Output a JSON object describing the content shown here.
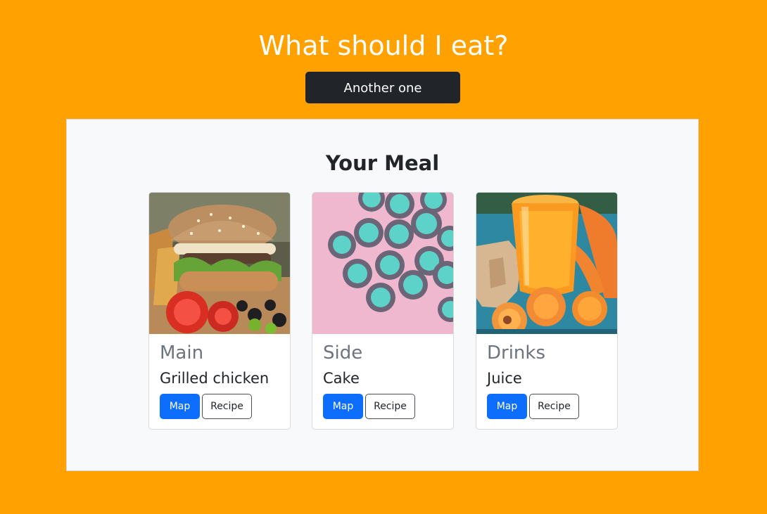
{
  "header": {
    "title": "What should I eat?",
    "another_button_label": "Another one"
  },
  "meal": {
    "title": "Your Meal",
    "cards": [
      {
        "category": "Main",
        "dish": "Grilled chicken",
        "image_alt": "burger-and-tomatoes-image",
        "map_label": "Map",
        "recipe_label": "Recipe"
      },
      {
        "category": "Side",
        "dish": "Cake",
        "image_alt": "cupcakes-image",
        "map_label": "Map",
        "recipe_label": "Recipe"
      },
      {
        "category": "Drinks",
        "dish": "Juice",
        "image_alt": "orange-juice-image",
        "map_label": "Map",
        "recipe_label": "Recipe"
      }
    ]
  },
  "colors": {
    "background": "#FFA100",
    "panel": "#F8F9FA",
    "dark_button": "#212529",
    "primary": "#0D6EFD"
  }
}
